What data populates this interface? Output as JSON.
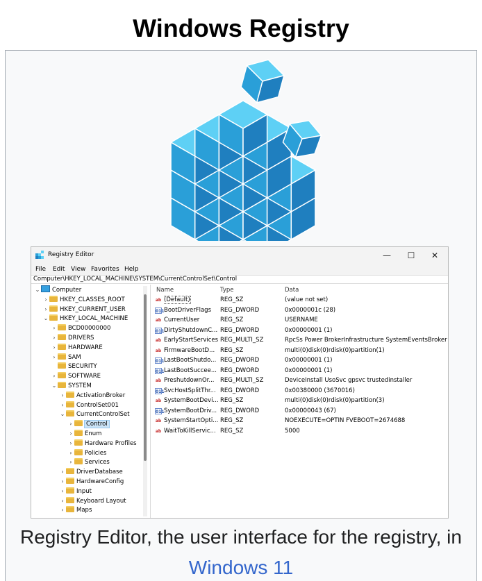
{
  "title": "Windows Registry",
  "window": {
    "title": "Registry Editor",
    "menu": [
      "File",
      "Edit",
      "View",
      "Favorites",
      "Help"
    ],
    "address": "Computer\\HKEY_LOCAL_MACHINE\\SYSTEM\\CurrentControlSet\\Control"
  },
  "tree": [
    {
      "label": "Computer",
      "depth": 0,
      "chev": "v",
      "icon": "computer"
    },
    {
      "label": "HKEY_CLASSES_ROOT",
      "depth": 1,
      "chev": ">"
    },
    {
      "label": "HKEY_CURRENT_USER",
      "depth": 1,
      "chev": ">"
    },
    {
      "label": "HKEY_LOCAL_MACHINE",
      "depth": 1,
      "chev": "v"
    },
    {
      "label": "BCD00000000",
      "depth": 2,
      "chev": ">"
    },
    {
      "label": "DRIVERS",
      "depth": 2,
      "chev": ">"
    },
    {
      "label": "HARDWARE",
      "depth": 2,
      "chev": ">"
    },
    {
      "label": "SAM",
      "depth": 2,
      "chev": ">"
    },
    {
      "label": "SECURITY",
      "depth": 2,
      "chev": ""
    },
    {
      "label": "SOFTWARE",
      "depth": 2,
      "chev": ">"
    },
    {
      "label": "SYSTEM",
      "depth": 2,
      "chev": "v"
    },
    {
      "label": "ActivationBroker",
      "depth": 3,
      "chev": ">"
    },
    {
      "label": "ControlSet001",
      "depth": 3,
      "chev": ">"
    },
    {
      "label": "CurrentControlSet",
      "depth": 3,
      "chev": "v"
    },
    {
      "label": "Control",
      "depth": 4,
      "chev": ">",
      "selected": true
    },
    {
      "label": "Enum",
      "depth": 4,
      "chev": ">"
    },
    {
      "label": "Hardware Profiles",
      "depth": 4,
      "chev": ">"
    },
    {
      "label": "Policies",
      "depth": 4,
      "chev": ">"
    },
    {
      "label": "Services",
      "depth": 4,
      "chev": ">"
    },
    {
      "label": "DriverDatabase",
      "depth": 3,
      "chev": ">"
    },
    {
      "label": "HardwareConfig",
      "depth": 3,
      "chev": ">"
    },
    {
      "label": "Input",
      "depth": 3,
      "chev": ">"
    },
    {
      "label": "Keyboard Layout",
      "depth": 3,
      "chev": ">"
    },
    {
      "label": "Maps",
      "depth": 3,
      "chev": ">"
    }
  ],
  "columns": {
    "name": "Name",
    "type": "Type",
    "data": "Data"
  },
  "values": [
    {
      "name": "(Default)",
      "type": "REG_SZ",
      "data": "(value not set)",
      "kind": "sz"
    },
    {
      "name": "BootDriverFlags",
      "type": "REG_DWORD",
      "data": "0x0000001c (28)",
      "kind": "bin"
    },
    {
      "name": "CurrentUser",
      "type": "REG_SZ",
      "data": "USERNAME",
      "kind": "sz"
    },
    {
      "name": "DirtyShutdownC...",
      "type": "REG_DWORD",
      "data": "0x00000001 (1)",
      "kind": "bin"
    },
    {
      "name": "EarlyStartServices",
      "type": "REG_MULTI_SZ",
      "data": "RpcSs Power BrokerInfrastructure SystemEventsBroker ...",
      "kind": "sz"
    },
    {
      "name": "FirmwareBootD...",
      "type": "REG_SZ",
      "data": "multi(0)disk(0)rdisk(0)partition(1)",
      "kind": "sz"
    },
    {
      "name": "LastBootShutdo...",
      "type": "REG_DWORD",
      "data": "0x00000001 (1)",
      "kind": "bin"
    },
    {
      "name": "LastBootSuccee...",
      "type": "REG_DWORD",
      "data": "0x00000001 (1)",
      "kind": "bin"
    },
    {
      "name": "PreshutdownOr...",
      "type": "REG_MULTI_SZ",
      "data": "DeviceInstall UsoSvc gpsvc trustedinstaller",
      "kind": "sz"
    },
    {
      "name": "SvcHostSplitThr...",
      "type": "REG_DWORD",
      "data": "0x00380000 (3670016)",
      "kind": "bin"
    },
    {
      "name": "SystemBootDevi...",
      "type": "REG_SZ",
      "data": "multi(0)disk(0)rdisk(0)partition(3)",
      "kind": "sz"
    },
    {
      "name": "SystemBootDriv...",
      "type": "REG_DWORD",
      "data": "0x00000043 (67)",
      "kind": "bin"
    },
    {
      "name": "SystemStartOpti...",
      "type": "REG_SZ",
      "data": " NOEXECUTE=OPTIN  FVEBOOT=2674688",
      "kind": "sz"
    },
    {
      "name": "WaitToKillServic...",
      "type": "REG_SZ",
      "data": "5000",
      "kind": "sz"
    }
  ],
  "caption": {
    "text": "Registry Editor, the user interface for the registry, in ",
    "link": "Windows 11"
  },
  "colors": {
    "cube_top": "#5ed0f5",
    "cube_left": "#2a9fd8",
    "cube_right": "#1f7fbf",
    "link": "#3366cc"
  }
}
